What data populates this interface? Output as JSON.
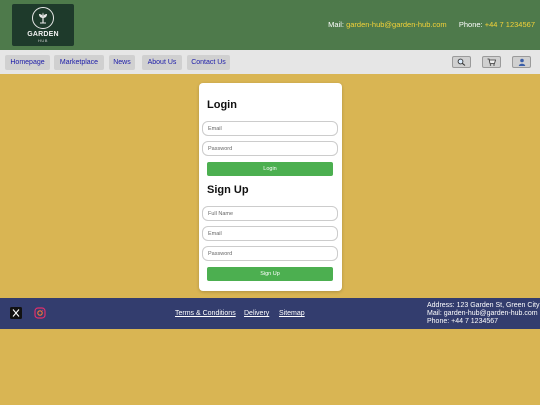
{
  "header": {
    "logo": {
      "title": "GARDEN",
      "subtitle": "HUB"
    },
    "contact": {
      "mail_label": "Mail:",
      "mail_value": "garden-hub@garden-hub.com",
      "phone_label": "Phone:",
      "phone_value": "+44 7 1234567"
    }
  },
  "nav": {
    "items": [
      {
        "label": "Homepage"
      },
      {
        "label": "Marketplace"
      },
      {
        "label": "News"
      },
      {
        "label": "About Us"
      },
      {
        "label": "Contact Us"
      }
    ],
    "icons": [
      "search-icon",
      "cart-icon",
      "user-icon"
    ]
  },
  "login": {
    "title": "Login",
    "email_placeholder": "Email",
    "password_placeholder": "Password",
    "button": "Login"
  },
  "signup": {
    "title": "Sign Up",
    "fullname_placeholder": "Full Name",
    "email_placeholder": "Email",
    "password_placeholder": "Password",
    "button": "Sign Up"
  },
  "footer": {
    "social_icons": [
      "x-icon",
      "instagram-icon"
    ],
    "links": [
      {
        "label": "Terms & Conditions"
      },
      {
        "label": "Delivery"
      },
      {
        "label": "Sitemap"
      }
    ],
    "address_line": "Address: 123 Garden St, Green City",
    "mail_line": "Mail: garden-hub@garden-hub.com",
    "phone_line": "Phone: +44 7 1234567"
  },
  "colors": {
    "header_bg": "#4e7a4b",
    "page_bg": "#d9b553",
    "footer_bg": "#333d6e",
    "accent_green": "#4caf50",
    "contact_highlight": "#f5d238",
    "nav_link": "#1a1aa8"
  }
}
